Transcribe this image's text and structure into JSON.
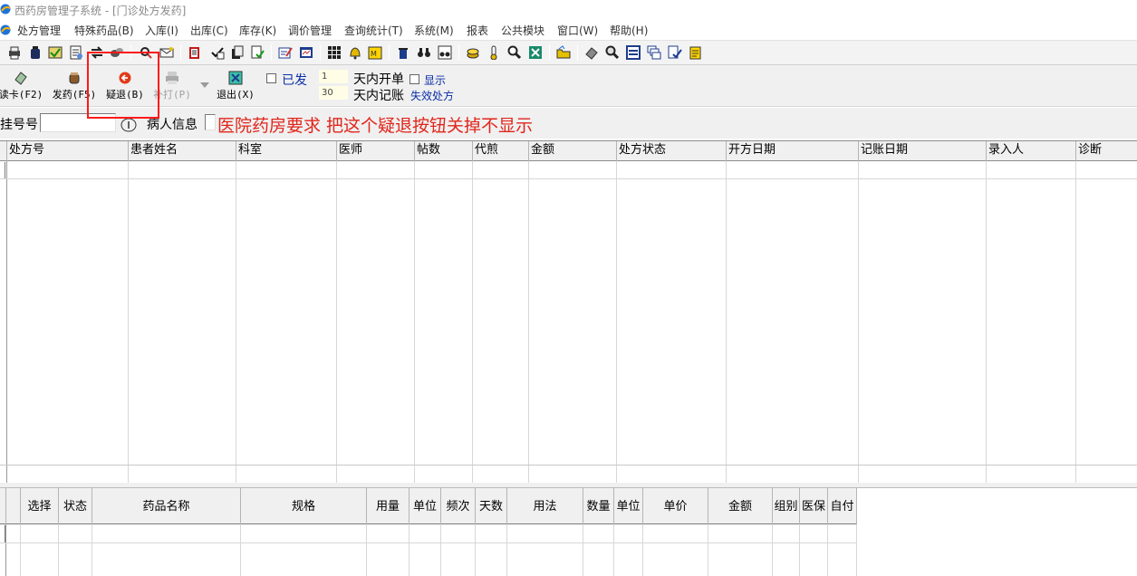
{
  "window": {
    "title": "西药房管理子系统 - [门诊处方发药]"
  },
  "menu": [
    "处方管理",
    "特殊药品(B)",
    "入库(I)",
    "出库(C)",
    "库存(K)",
    "调价管理",
    "查询统计(T)",
    "系统(M)",
    "报表",
    "公共模块",
    "窗口(W)",
    "帮助(H)"
  ],
  "toolbar2": {
    "read_card": "读卡(F2)",
    "dispense": "发药(F5)",
    "return": "疑退(B)",
    "reprint": "补打(P)",
    "exit": "退出(X)",
    "dispensed_label": "已发",
    "open_days_value": "1",
    "open_days_label": "天内开单",
    "account_days_value": "30",
    "account_days_label": "天内记账",
    "show_label": "显示",
    "invalid_label": "失效处方"
  },
  "search": {
    "reg_label": "挂号号",
    "reg_value": "",
    "patient_label": "病人信息",
    "annotation": "医院药房要求 把这个疑退按钮关掉不显示"
  },
  "prescription_columns": [
    "处方号",
    "患者姓名",
    "科室",
    "医师",
    "帖数",
    "代煎",
    "金额",
    "处方状态",
    "开方日期",
    "记账日期",
    "录入人",
    "诊断"
  ],
  "detail_columns": [
    "选择",
    "状态",
    "药品名称",
    "规格",
    "用量",
    "单位",
    "频次",
    "天数",
    "用法",
    "数量",
    "单位",
    "单价",
    "金额",
    "组别",
    "医保",
    "自付"
  ],
  "colors": {
    "annotation": "#e1251b",
    "highlight_box": "#ff1a1a",
    "link_blue": "#0a2ea8"
  }
}
